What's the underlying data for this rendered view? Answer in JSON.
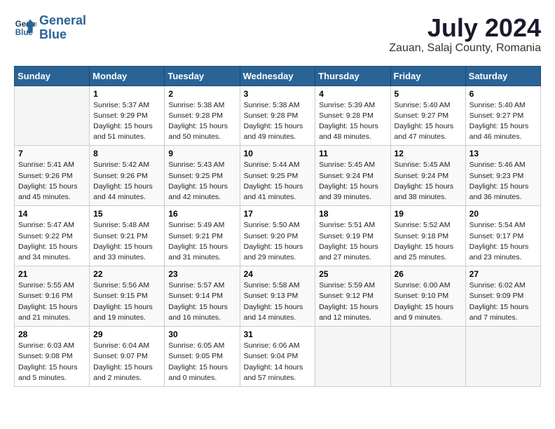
{
  "logo": {
    "line1": "General",
    "line2": "Blue"
  },
  "title": "July 2024",
  "location": "Zauan, Salaj County, Romania",
  "days_of_week": [
    "Sunday",
    "Monday",
    "Tuesday",
    "Wednesday",
    "Thursday",
    "Friday",
    "Saturday"
  ],
  "weeks": [
    [
      {
        "num": "",
        "info": ""
      },
      {
        "num": "1",
        "info": "Sunrise: 5:37 AM\nSunset: 9:29 PM\nDaylight: 15 hours\nand 51 minutes."
      },
      {
        "num": "2",
        "info": "Sunrise: 5:38 AM\nSunset: 9:28 PM\nDaylight: 15 hours\nand 50 minutes."
      },
      {
        "num": "3",
        "info": "Sunrise: 5:38 AM\nSunset: 9:28 PM\nDaylight: 15 hours\nand 49 minutes."
      },
      {
        "num": "4",
        "info": "Sunrise: 5:39 AM\nSunset: 9:28 PM\nDaylight: 15 hours\nand 48 minutes."
      },
      {
        "num": "5",
        "info": "Sunrise: 5:40 AM\nSunset: 9:27 PM\nDaylight: 15 hours\nand 47 minutes."
      },
      {
        "num": "6",
        "info": "Sunrise: 5:40 AM\nSunset: 9:27 PM\nDaylight: 15 hours\nand 46 minutes."
      }
    ],
    [
      {
        "num": "7",
        "info": "Sunrise: 5:41 AM\nSunset: 9:26 PM\nDaylight: 15 hours\nand 45 minutes."
      },
      {
        "num": "8",
        "info": "Sunrise: 5:42 AM\nSunset: 9:26 PM\nDaylight: 15 hours\nand 44 minutes."
      },
      {
        "num": "9",
        "info": "Sunrise: 5:43 AM\nSunset: 9:25 PM\nDaylight: 15 hours\nand 42 minutes."
      },
      {
        "num": "10",
        "info": "Sunrise: 5:44 AM\nSunset: 9:25 PM\nDaylight: 15 hours\nand 41 minutes."
      },
      {
        "num": "11",
        "info": "Sunrise: 5:45 AM\nSunset: 9:24 PM\nDaylight: 15 hours\nand 39 minutes."
      },
      {
        "num": "12",
        "info": "Sunrise: 5:45 AM\nSunset: 9:24 PM\nDaylight: 15 hours\nand 38 minutes."
      },
      {
        "num": "13",
        "info": "Sunrise: 5:46 AM\nSunset: 9:23 PM\nDaylight: 15 hours\nand 36 minutes."
      }
    ],
    [
      {
        "num": "14",
        "info": "Sunrise: 5:47 AM\nSunset: 9:22 PM\nDaylight: 15 hours\nand 34 minutes."
      },
      {
        "num": "15",
        "info": "Sunrise: 5:48 AM\nSunset: 9:21 PM\nDaylight: 15 hours\nand 33 minutes."
      },
      {
        "num": "16",
        "info": "Sunrise: 5:49 AM\nSunset: 9:21 PM\nDaylight: 15 hours\nand 31 minutes."
      },
      {
        "num": "17",
        "info": "Sunrise: 5:50 AM\nSunset: 9:20 PM\nDaylight: 15 hours\nand 29 minutes."
      },
      {
        "num": "18",
        "info": "Sunrise: 5:51 AM\nSunset: 9:19 PM\nDaylight: 15 hours\nand 27 minutes."
      },
      {
        "num": "19",
        "info": "Sunrise: 5:52 AM\nSunset: 9:18 PM\nDaylight: 15 hours\nand 25 minutes."
      },
      {
        "num": "20",
        "info": "Sunrise: 5:54 AM\nSunset: 9:17 PM\nDaylight: 15 hours\nand 23 minutes."
      }
    ],
    [
      {
        "num": "21",
        "info": "Sunrise: 5:55 AM\nSunset: 9:16 PM\nDaylight: 15 hours\nand 21 minutes."
      },
      {
        "num": "22",
        "info": "Sunrise: 5:56 AM\nSunset: 9:15 PM\nDaylight: 15 hours\nand 19 minutes."
      },
      {
        "num": "23",
        "info": "Sunrise: 5:57 AM\nSunset: 9:14 PM\nDaylight: 15 hours\nand 16 minutes."
      },
      {
        "num": "24",
        "info": "Sunrise: 5:58 AM\nSunset: 9:13 PM\nDaylight: 15 hours\nand 14 minutes."
      },
      {
        "num": "25",
        "info": "Sunrise: 5:59 AM\nSunset: 9:12 PM\nDaylight: 15 hours\nand 12 minutes."
      },
      {
        "num": "26",
        "info": "Sunrise: 6:00 AM\nSunset: 9:10 PM\nDaylight: 15 hours\nand 9 minutes."
      },
      {
        "num": "27",
        "info": "Sunrise: 6:02 AM\nSunset: 9:09 PM\nDaylight: 15 hours\nand 7 minutes."
      }
    ],
    [
      {
        "num": "28",
        "info": "Sunrise: 6:03 AM\nSunset: 9:08 PM\nDaylight: 15 hours\nand 5 minutes."
      },
      {
        "num": "29",
        "info": "Sunrise: 6:04 AM\nSunset: 9:07 PM\nDaylight: 15 hours\nand 2 minutes."
      },
      {
        "num": "30",
        "info": "Sunrise: 6:05 AM\nSunset: 9:05 PM\nDaylight: 15 hours\nand 0 minutes."
      },
      {
        "num": "31",
        "info": "Sunrise: 6:06 AM\nSunset: 9:04 PM\nDaylight: 14 hours\nand 57 minutes."
      },
      {
        "num": "",
        "info": ""
      },
      {
        "num": "",
        "info": ""
      },
      {
        "num": "",
        "info": ""
      }
    ]
  ]
}
